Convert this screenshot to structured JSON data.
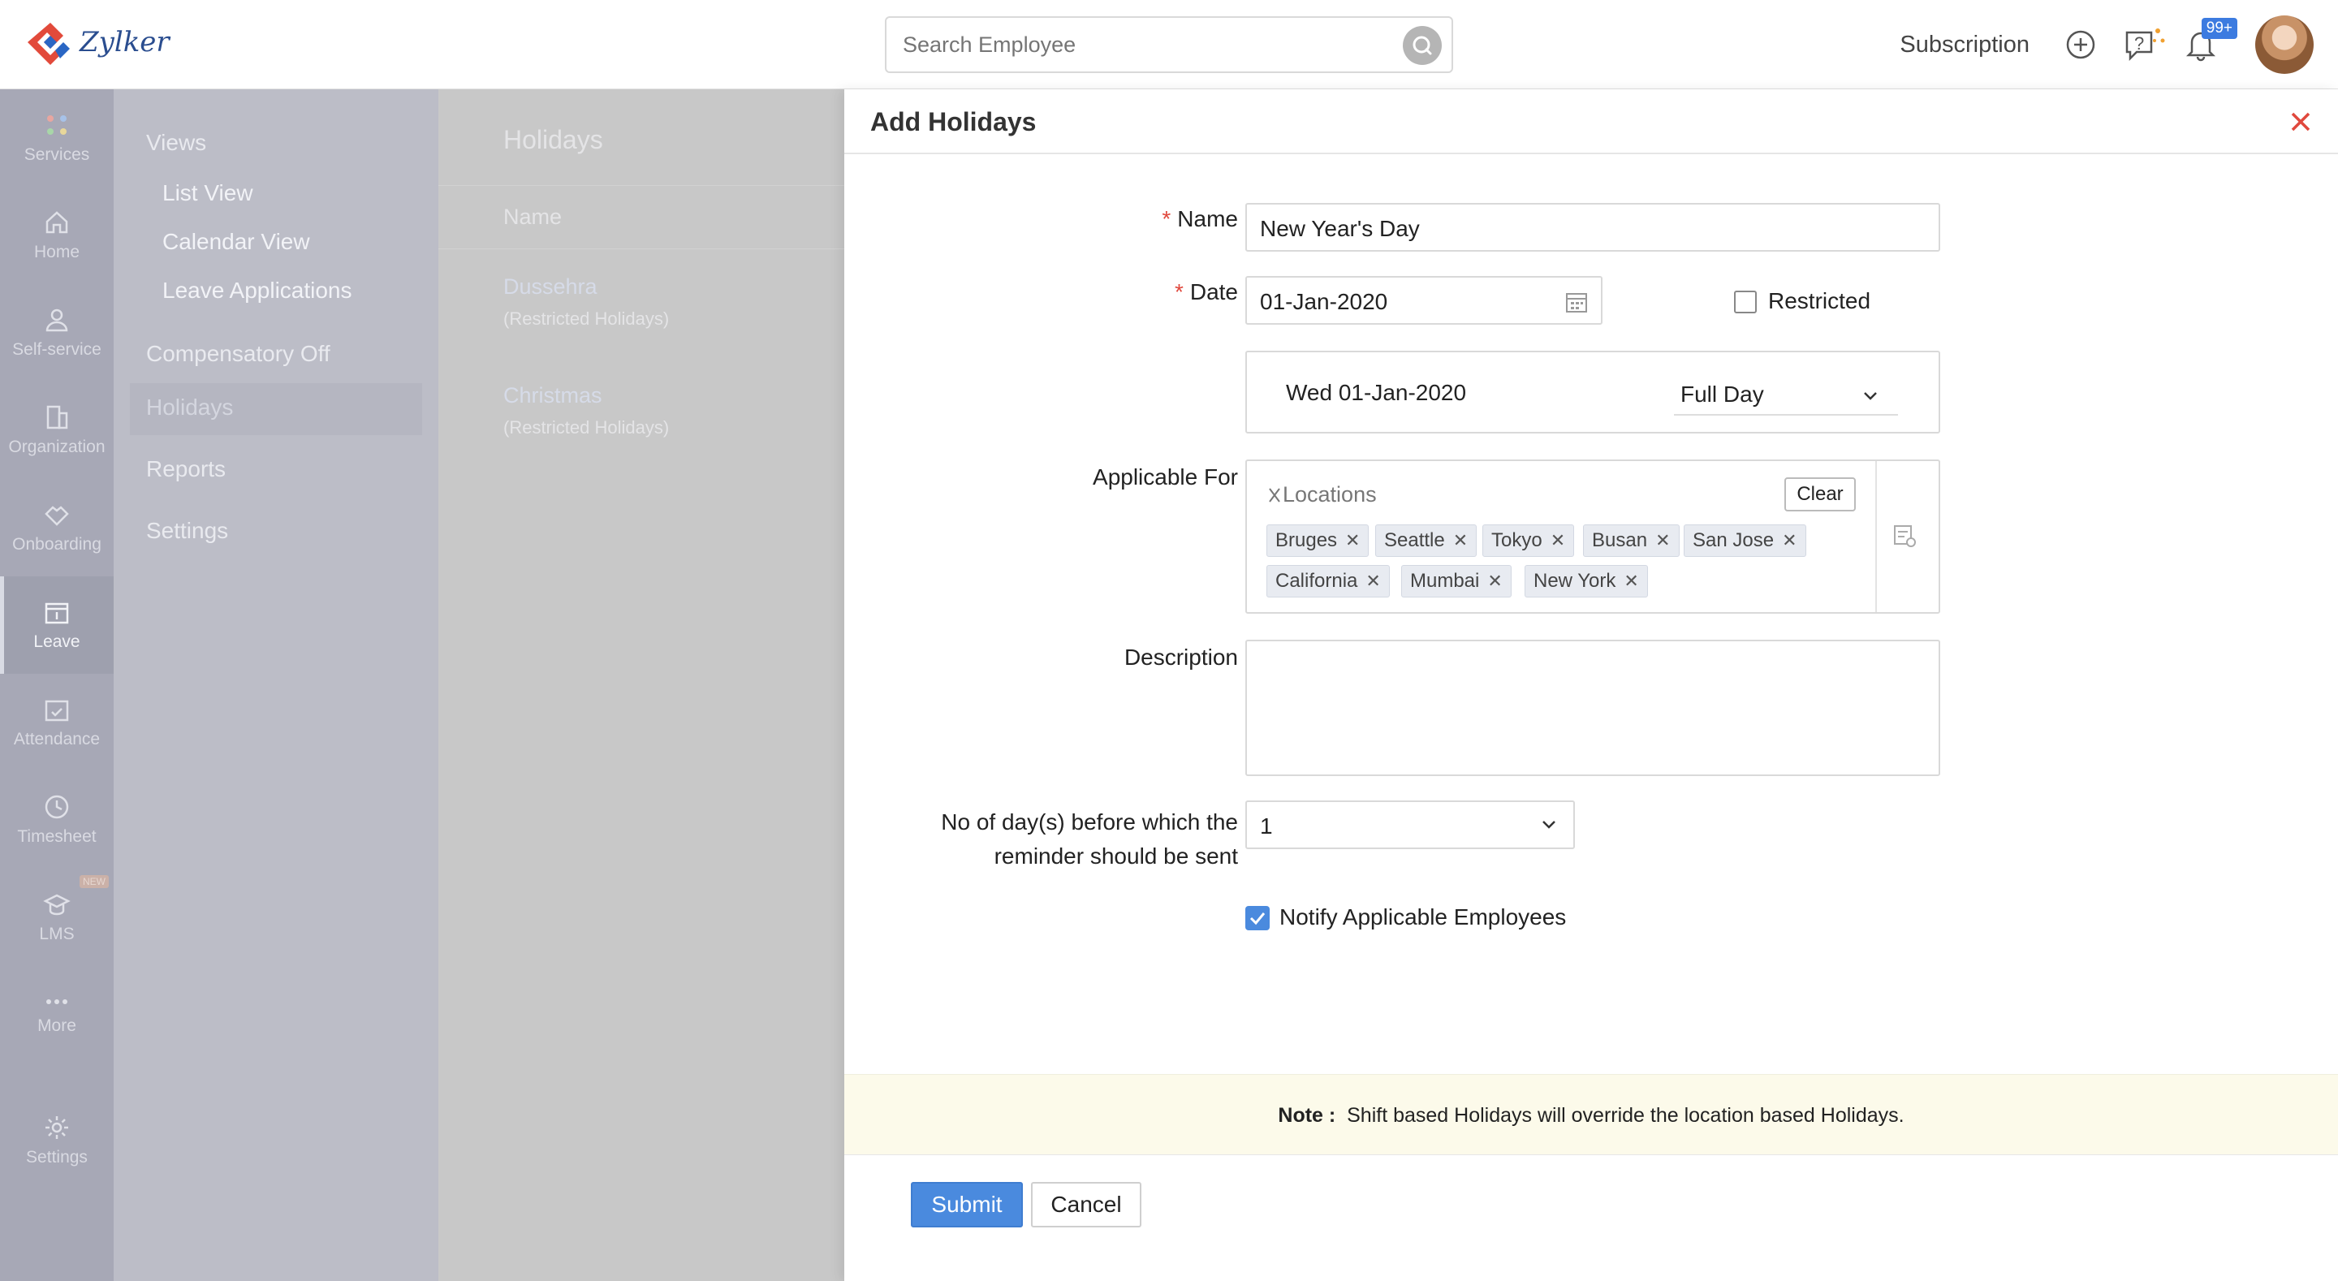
{
  "topbar": {
    "logo_text": "Zylker",
    "search_placeholder": "Search Employee",
    "subscription_label": "Subscription",
    "notification_badge": "99+"
  },
  "rail": {
    "items": [
      {
        "label": "Services",
        "icon": "grid-dots-icon"
      },
      {
        "label": "Home",
        "icon": "home-icon"
      },
      {
        "label": "Self-service",
        "icon": "user-icon"
      },
      {
        "label": "Organization",
        "icon": "building-icon"
      },
      {
        "label": "Onboarding",
        "icon": "handshake-icon"
      },
      {
        "label": "Leave",
        "icon": "calendar-leave-icon",
        "active": true
      },
      {
        "label": "Attendance",
        "icon": "calendar-check-icon"
      },
      {
        "label": "Timesheet",
        "icon": "clock-icon"
      },
      {
        "label": "LMS",
        "icon": "graduation-cap-icon",
        "tag": "NEW"
      },
      {
        "label": "More",
        "icon": "more-dots-icon"
      },
      {
        "label": "Settings",
        "icon": "gear-icon"
      }
    ]
  },
  "submenu": {
    "views_label": "Views",
    "list_view": "List View",
    "calendar_view": "Calendar View",
    "leave_applications": "Leave Applications",
    "compensatory_off": "Compensatory Off",
    "holidays": "Holidays",
    "reports": "Reports",
    "settings": "Settings"
  },
  "list_bg": {
    "title": "Holidays",
    "column": "Name",
    "rows": [
      {
        "name": "Dussehra",
        "sub": "(Restricted Holidays)"
      },
      {
        "name": "Christmas",
        "sub": "(Restricted Holidays)"
      }
    ]
  },
  "panel": {
    "title": "Add Holidays",
    "name_label": "Name",
    "name_value": "New Year's Day",
    "date_label": "Date",
    "date_value": "01-Jan-2020",
    "restricted_label": "Restricted",
    "restricted_checked": false,
    "day_row_date": "Wed 01-Jan-2020",
    "day_row_type": "Full Day",
    "applicable_label": "Applicable For",
    "locations_label": "Locations",
    "clear_label": "Clear",
    "locations": [
      "Bruges",
      "Seattle",
      "Tokyo",
      "Busan",
      "San Jose",
      "California",
      "Mumbai",
      "New York"
    ],
    "description_label": "Description",
    "description_value": "",
    "reminder_label_line1": "No of day(s) before which the",
    "reminder_label_line2": "reminder should be sent",
    "reminder_value": "1",
    "notify_label": "Notify Applicable Employees",
    "notify_checked": true,
    "note_prefix": "Note :",
    "note_text": "Shift based Holidays will override the location based Holidays.",
    "submit_label": "Submit",
    "cancel_label": "Cancel"
  },
  "colors": {
    "accent": "#4a8ade",
    "close": "#e0483d",
    "rail_bg": "#a7a8b6",
    "note_bg": "#fcfaea"
  }
}
